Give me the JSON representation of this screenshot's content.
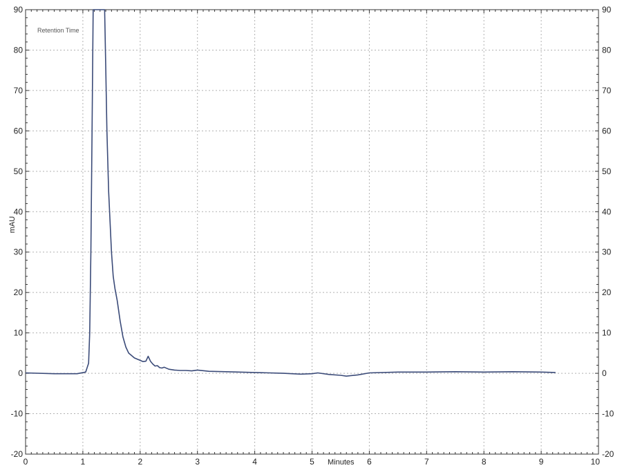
{
  "chart_data": {
    "type": "line",
    "legend_text": "Retention Time",
    "xlabel": "Minutes",
    "ylabel": "mAU",
    "xlim": [
      0,
      10
    ],
    "ylim": [
      -20,
      90
    ],
    "x_ticks": [
      0,
      1,
      2,
      3,
      4,
      5,
      6,
      7,
      8,
      9,
      10
    ],
    "y_ticks": [
      -20,
      -10,
      0,
      10,
      20,
      30,
      40,
      50,
      60,
      70,
      80,
      90
    ],
    "grid": true,
    "right_axis_mirrored": true,
    "line_color": "#3a4a78",
    "grid_color": "#b0b0b0",
    "series": [
      {
        "x": [
          0,
          0.5,
          0.9,
          1.05,
          1.1,
          1.12,
          1.14,
          1.16,
          1.18,
          1.2,
          1.3,
          1.38,
          1.4,
          1.42,
          1.45,
          1.5,
          1.53,
          1.56,
          1.6,
          1.65,
          1.7,
          1.75,
          1.8,
          1.9,
          2.0,
          2.05,
          2.1,
          2.14,
          2.18,
          2.22,
          2.26,
          2.3,
          2.34,
          2.38,
          2.42,
          2.5,
          2.6,
          2.7,
          2.8,
          2.9,
          3.0,
          3.2,
          3.5,
          4.0,
          4.5,
          4.8,
          5.0,
          5.1,
          5.3,
          5.5,
          5.6,
          5.8,
          6.0,
          6.5,
          7.0,
          7.5,
          8.0,
          8.5,
          9.0,
          9.25
        ],
        "y": [
          0.1,
          -0.1,
          -0.1,
          0.3,
          2.5,
          10,
          30,
          60,
          90,
          90,
          90,
          90,
          75,
          60,
          45,
          30,
          24,
          21,
          18,
          13,
          9,
          6.5,
          5,
          3.8,
          3.2,
          2.9,
          3.0,
          4.2,
          3.0,
          2.3,
          1.8,
          1.9,
          1.4,
          1.3,
          1.5,
          1.0,
          0.8,
          0.7,
          0.7,
          0.6,
          0.8,
          0.5,
          0.4,
          0.2,
          0.0,
          -0.2,
          -0.1,
          0.1,
          -0.3,
          -0.5,
          -0.7,
          -0.4,
          0.1,
          0.3,
          0.3,
          0.4,
          0.3,
          0.4,
          0.3,
          0.2
        ]
      }
    ]
  }
}
